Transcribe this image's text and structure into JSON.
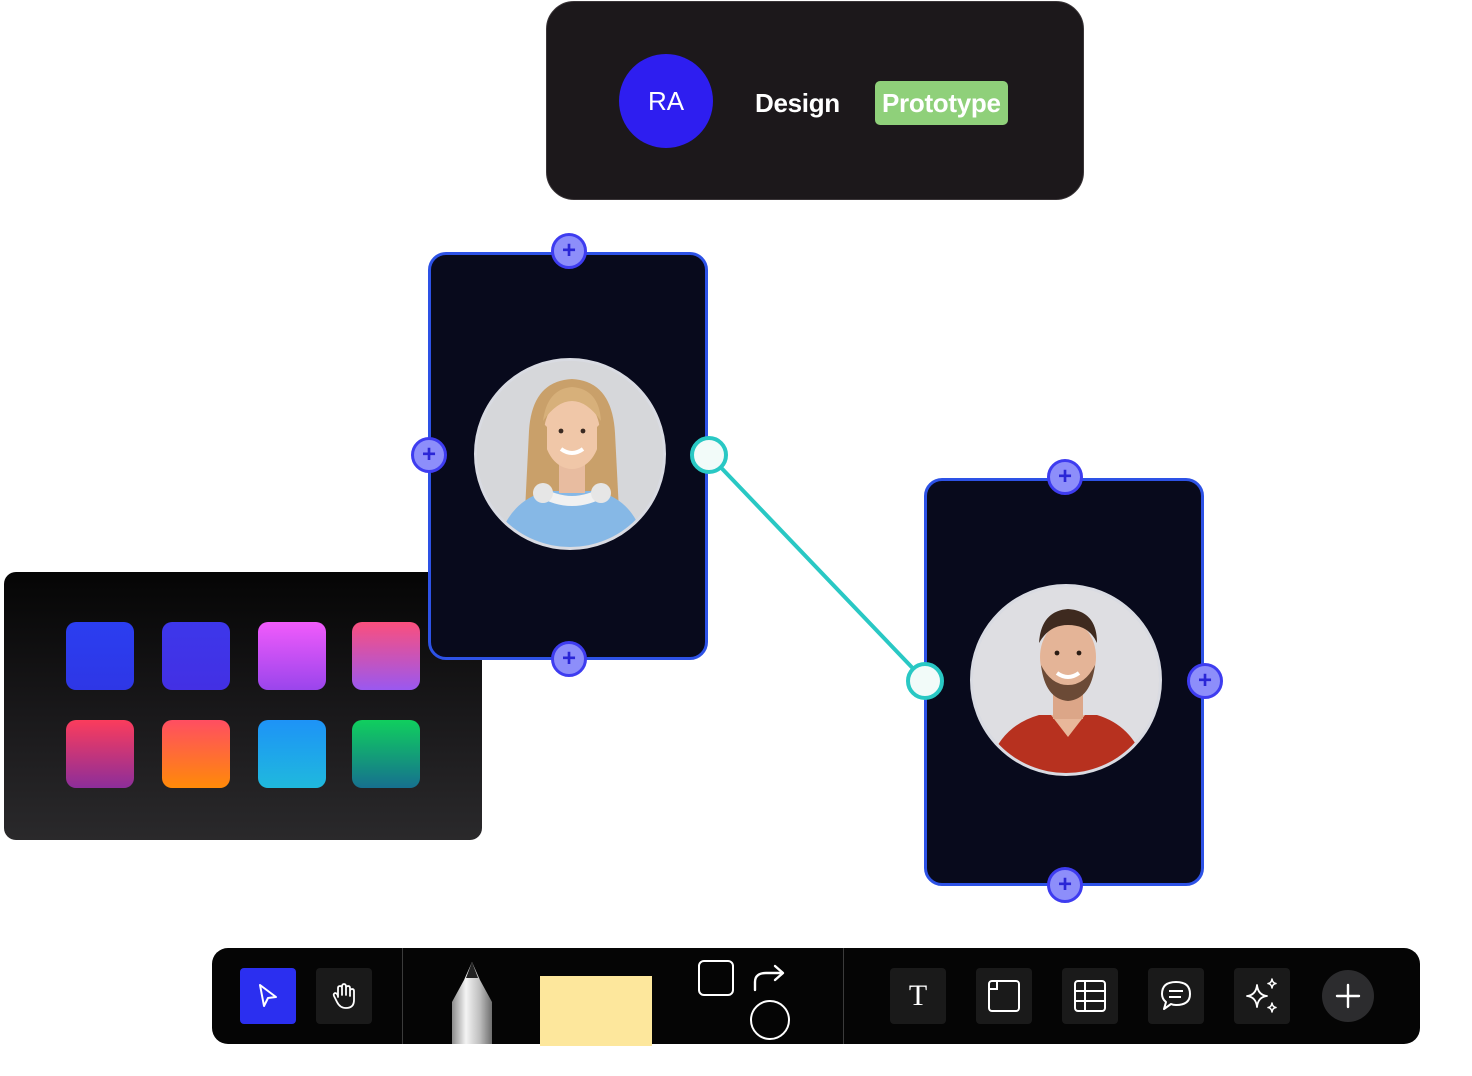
{
  "header": {
    "avatar_initials": "RA",
    "mode_label": "Design",
    "mode_active": "Prototype",
    "avatar_color": "#2e1ef0",
    "active_pill_color": "#8fd07a"
  },
  "swatches": [
    {
      "name": "royal-blue",
      "from": "#2b3ef0",
      "to": "#2e37e6"
    },
    {
      "name": "indigo",
      "from": "#3d37ea",
      "to": "#4330e4"
    },
    {
      "name": "magenta-violet",
      "from": "#f15bfb",
      "to": "#9a45ec"
    },
    {
      "name": "pink-purple",
      "from": "#fb4f7d",
      "to": "#9a58f0"
    },
    {
      "name": "red-plum",
      "from": "#fb3c5c",
      "to": "#8c2e9a"
    },
    {
      "name": "coral-orange",
      "from": "#ff4e62",
      "to": "#ff8a08"
    },
    {
      "name": "sky-blue",
      "from": "#1e93f7",
      "to": "#1fb9dd"
    },
    {
      "name": "green-teal",
      "from": "#10cf5e",
      "to": "#16708f"
    }
  ],
  "cards": {
    "woman": {
      "accent": "#2d52e6"
    },
    "man": {
      "accent": "#2d52e6"
    }
  },
  "connector_color": "#29c8c4",
  "handle_symbol": "+",
  "toolbar": {
    "icons": [
      "cursor-icon",
      "hand-icon",
      "pen-icon",
      "sticky-note",
      "square-icon",
      "arrow-icon",
      "circle-icon",
      "text-icon",
      "frame-icon",
      "table-icon",
      "comment-icon",
      "sparkle-icon",
      "add-icon"
    ],
    "text_tool_glyph": "T",
    "active_color": "#2b2ff0"
  }
}
